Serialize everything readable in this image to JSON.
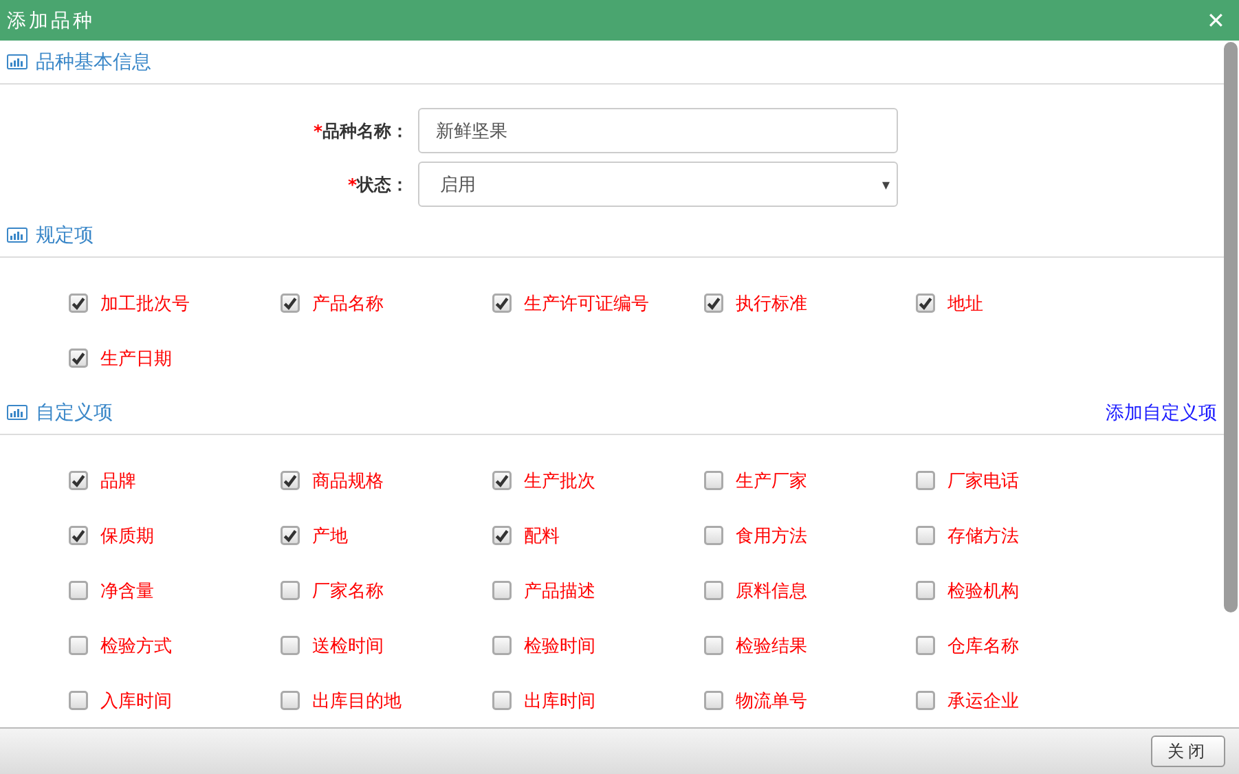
{
  "window": {
    "title": "添加品种",
    "close": "✕"
  },
  "basic_section": {
    "title": "品种基本信息",
    "fields": [
      {
        "kind": "text",
        "label": "品种名称：",
        "required_mark": "*",
        "value": "新鲜坚果"
      },
      {
        "kind": "select",
        "label": "状态：",
        "required_mark": "*",
        "value": "启用",
        "caret": "▾"
      }
    ]
  },
  "required_section": {
    "title": "规定项",
    "items": [
      {
        "label": "加工批次号",
        "checked": true
      },
      {
        "label": "产品名称",
        "checked": true
      },
      {
        "label": "生产许可证编号",
        "checked": true
      },
      {
        "label": "执行标准",
        "checked": true
      },
      {
        "label": "地址",
        "checked": true
      },
      {
        "label": "生产日期",
        "checked": true
      }
    ]
  },
  "custom_section": {
    "title": "自定义项",
    "action_link": "添加自定义项",
    "items": [
      {
        "label": "品牌",
        "checked": true
      },
      {
        "label": "商品规格",
        "checked": true
      },
      {
        "label": "生产批次",
        "checked": true
      },
      {
        "label": "生产厂家",
        "checked": false
      },
      {
        "label": "厂家电话",
        "checked": false
      },
      {
        "label": "保质期",
        "checked": true
      },
      {
        "label": "产地",
        "checked": true
      },
      {
        "label": "配料",
        "checked": true
      },
      {
        "label": "食用方法",
        "checked": false
      },
      {
        "label": "存储方法",
        "checked": false
      },
      {
        "label": "净含量",
        "checked": false
      },
      {
        "label": "厂家名称",
        "checked": false
      },
      {
        "label": "产品描述",
        "checked": false
      },
      {
        "label": "原料信息",
        "checked": false
      },
      {
        "label": "检验机构",
        "checked": false
      },
      {
        "label": "检验方式",
        "checked": false
      },
      {
        "label": "送检时间",
        "checked": false
      },
      {
        "label": "检验时间",
        "checked": false
      },
      {
        "label": "检验结果",
        "checked": false
      },
      {
        "label": "仓库名称",
        "checked": false
      },
      {
        "label": "入库时间",
        "checked": false
      },
      {
        "label": "出库目的地",
        "checked": false
      },
      {
        "label": "出库时间",
        "checked": false
      },
      {
        "label": "物流单号",
        "checked": false
      },
      {
        "label": "承运企业",
        "checked": false
      }
    ]
  },
  "footer": {
    "buttons": [
      "关闭"
    ]
  }
}
